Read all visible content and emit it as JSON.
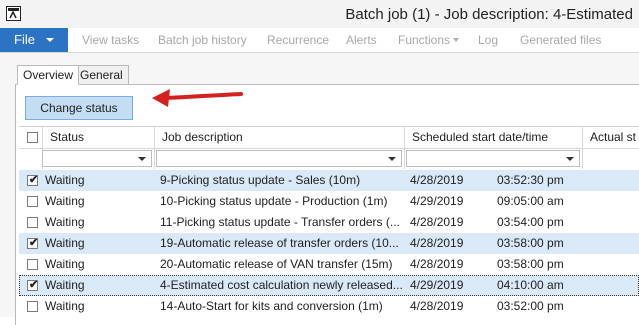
{
  "window": {
    "title": "Batch job (1) - Job description: 4-Estimated",
    "app_icon": "dynamics-ax-icon"
  },
  "menubar": {
    "file_label": "File",
    "items": [
      "View tasks",
      "Batch job history",
      "Recurrence",
      "Alerts",
      "Functions",
      "Log",
      "Generated files"
    ]
  },
  "tabs": [
    "Overview",
    "General"
  ],
  "toolbar": {
    "change_status_label": "Change status",
    "annotation_arrow_color": "#d61f1f"
  },
  "grid": {
    "columns": [
      "Status",
      "Job description",
      "Scheduled start date/time",
      "Actual st"
    ],
    "rows": [
      {
        "checked": true,
        "status": "Waiting",
        "description": "9-Picking status update - Sales (10m)",
        "date": "4/28/2019",
        "time": "03:52:30 pm",
        "selected": true,
        "current": false
      },
      {
        "checked": false,
        "status": "Waiting",
        "description": "10-Picking status update - Production (1m)",
        "date": "4/29/2019",
        "time": "09:05:00 am",
        "selected": false,
        "current": false
      },
      {
        "checked": false,
        "status": "Waiting",
        "description": "11-Picking status update - Transfer orders (...",
        "date": "4/28/2019",
        "time": "03:54:00 pm",
        "selected": false,
        "current": false
      },
      {
        "checked": true,
        "status": "Waiting",
        "description": "19-Automatic release of transfer orders (10...",
        "date": "4/28/2019",
        "time": "03:58:00 pm",
        "selected": true,
        "current": false
      },
      {
        "checked": false,
        "status": "Waiting",
        "description": "20-Automatic release of VAN transfer (15m)",
        "date": "4/28/2019",
        "time": "03:58:00 pm",
        "selected": false,
        "current": false
      },
      {
        "checked": true,
        "status": "Waiting",
        "description": "4-Estimated cost calculation newly released...",
        "date": "4/29/2019",
        "time": "04:10:00 am",
        "selected": true,
        "current": true
      },
      {
        "checked": false,
        "status": "Waiting",
        "description": "14-Auto-Start for kits and conversion (1m)",
        "date": "4/28/2019",
        "time": "03:52:00 pm",
        "selected": false,
        "current": false
      }
    ]
  }
}
